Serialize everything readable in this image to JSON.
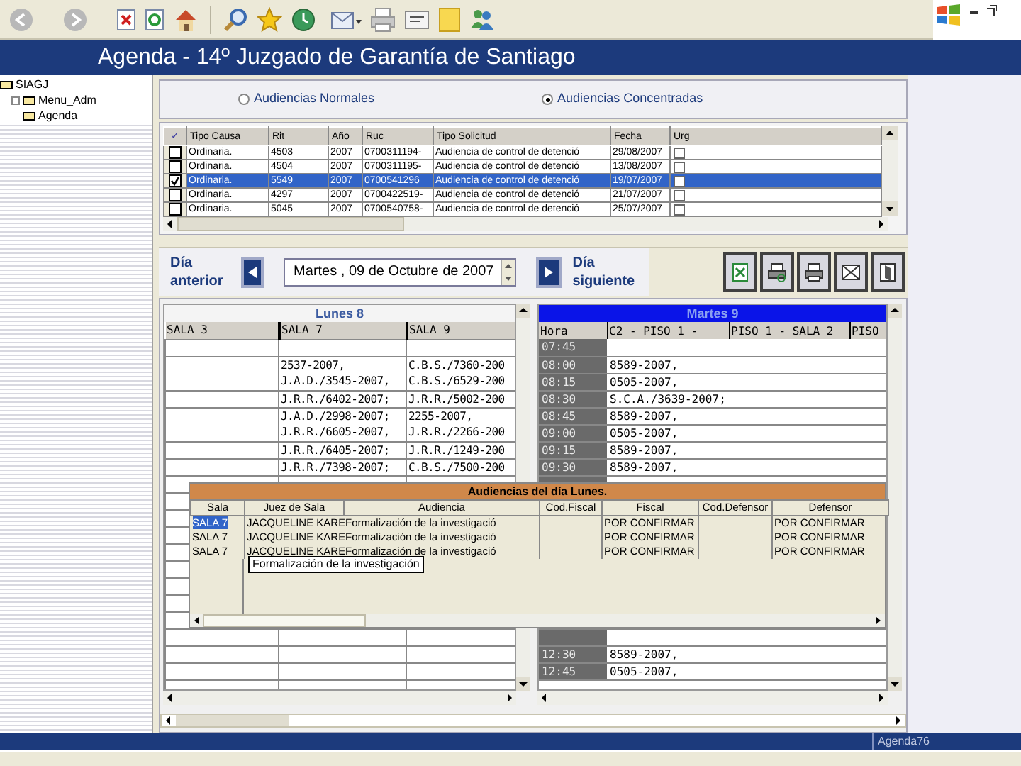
{
  "title": "Agenda - 14º Juzgado de Garantía de Santiago",
  "tree": [
    {
      "label": "SIAGJ",
      "children": [
        {
          "label": "Menu_Adm",
          "children": [
            {
              "label": "Agenda"
            }
          ]
        }
      ]
    }
  ],
  "mode_options": [
    {
      "label": "Audiencias Normales",
      "selected": false
    },
    {
      "label": "Audiencias Concentradas",
      "selected": true
    }
  ],
  "causes_table": {
    "check_header": "✓",
    "columns": [
      "Tipo Causa",
      "Rit",
      "Año",
      "Ruc",
      "Tipo Solicitud",
      "Fecha",
      "Urg"
    ],
    "rows": [
      {
        "checked": false,
        "selected": false,
        "urgent": false,
        "cells": [
          "Ordinaria.",
          "4503",
          "2007",
          "0700311194-",
          "Audiencia de control de detenció",
          "29/08/2007"
        ]
      },
      {
        "checked": false,
        "selected": false,
        "urgent": false,
        "cells": [
          "Ordinaria.",
          "4504",
          "2007",
          "0700311195-",
          "Audiencia de control de detenció",
          "13/08/2007"
        ]
      },
      {
        "checked": true,
        "selected": true,
        "urgent": false,
        "cells": [
          "Ordinaria.",
          "5549",
          "2007",
          "0700541296",
          "Audiencia de control de detenció",
          "19/07/2007"
        ]
      },
      {
        "checked": false,
        "selected": false,
        "urgent": false,
        "cells": [
          "Ordinaria.",
          "4297",
          "2007",
          "0700422519-",
          "Audiencia de control de detenció",
          "21/07/2007"
        ]
      },
      {
        "checked": false,
        "selected": false,
        "urgent": false,
        "cells": [
          "Ordinaria.",
          "5045",
          "2007",
          "0700540758-",
          "Audiencia de control de detenció",
          "25/07/2007"
        ]
      }
    ]
  },
  "navigation": {
    "previous_label": "Día anterior",
    "date": "Martes , 09 de Octubre de 2007",
    "next_label": "Día siguiente"
  },
  "monday": {
    "title": "Lunes 8",
    "columns": [
      "SALA 3",
      "SALA 7",
      "SALA 9"
    ],
    "rows": [
      {
        "lines": []
      },
      {
        "lines": [
          {
            "sala_7": "2537-2007,",
            "sala_9": "C.B.S./7360-200"
          },
          {
            "sala_7": "J.A.D./3545-2007,",
            "sala_9": "C.B.S./6529-200"
          }
        ]
      },
      {
        "lines": [
          {
            "sala_7": "J.R.R./6402-2007;",
            "sala_9": "J.R.R./5002-200"
          }
        ]
      },
      {
        "lines": [
          {
            "sala_7": "J.A.D./2998-2007;",
            "sala_9": "2255-2007,"
          },
          {
            "sala_7": "J.R.R./6605-2007,",
            "sala_9": "J.R.R./2266-200"
          }
        ]
      },
      {
        "lines": [
          {
            "sala_7": "J.R.R./6405-2007;",
            "sala_9": "J.R.R./1249-200"
          }
        ]
      },
      {
        "lines": [
          {
            "sala_7": "J.R.R./7398-2007;",
            "sala_9": "C.B.S./7500-200"
          }
        ]
      }
    ]
  },
  "tuesday": {
    "title": "Martes 9",
    "columns": [
      "Hora",
      "C2 - PISO 1 -",
      "PISO 1 - SALA 2",
      "PISO"
    ],
    "rows_top": [
      {
        "time": "07:45"
      },
      {
        "time": "08:00",
        "entry": "8589-2007,"
      },
      {
        "time": "08:15",
        "entry": "0505-2007,"
      },
      {
        "time": "08:30",
        "entry": "S.C.A./3639-2007;"
      },
      {
        "time": "08:45",
        "entry": "8589-2007,"
      },
      {
        "time": "09:00",
        "entry": "0505-2007,"
      },
      {
        "time": "09:15",
        "entry": "8589-2007,"
      },
      {
        "time": "09:30",
        "entry": "8589-2007,"
      }
    ],
    "rows_bottom": [
      {
        "time": "12:30",
        "entry": "8589-2007,"
      },
      {
        "time": "12:45",
        "entry": "0505-2007,"
      }
    ]
  },
  "hearings_popup": {
    "title": "Audiencias del día Lunes.",
    "columns": [
      "Sala",
      "Juez de Sala",
      "Audiencia",
      "Cod.Fiscal",
      "Fiscal",
      "Cod.Defensor",
      "Defensor"
    ],
    "rows": [
      {
        "selected": true,
        "sala": "SALA 7",
        "juez": "JACQUELINE KARE",
        "audiencia": "Formalización de la investigació",
        "fiscal": "POR CONFIRMAR",
        "defensor": "POR CONFIRMAR"
      },
      {
        "selected": false,
        "sala": "SALA 7",
        "juez": "JACQUELINE KARE",
        "audiencia": "Formalización de la investigació",
        "fiscal": "POR CONFIRMAR",
        "defensor": "POR CONFIRMAR"
      },
      {
        "selected": false,
        "sala": "SALA 7",
        "juez": "JACQUELINE KARE",
        "audiencia": "Formalización de la investigació",
        "fiscal": "POR CONFIRMAR",
        "defensor": "POR CONFIRMAR"
      }
    ],
    "tooltip": "Formalización de la investigación"
  },
  "status_bar": {
    "text": "Agenda76"
  }
}
